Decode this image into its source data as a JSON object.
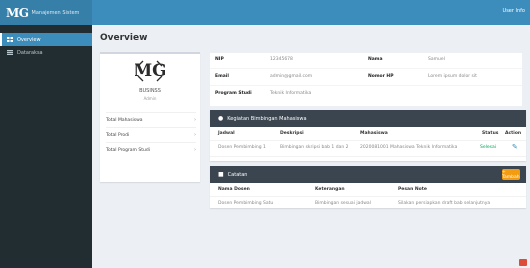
{
  "app": {
    "logo": "MG",
    "name": "Manajemen Sistem",
    "user": "User Info"
  },
  "sidebar": {
    "items": [
      {
        "label": "Overview",
        "icon": "dashboard-icon",
        "active": true
      },
      {
        "label": "Dataraksa",
        "icon": "database-icon",
        "active": false
      }
    ]
  },
  "page": {
    "title": "Overview"
  },
  "profile": {
    "name": "BUSINSS",
    "subtitle": "Admin",
    "links": [
      {
        "label": "Total Mahasiswa"
      },
      {
        "label": "Total Prodi"
      },
      {
        "label": "Total Program Studi"
      }
    ]
  },
  "info": {
    "rows": [
      {
        "l1": "NIP",
        "v1": "12345678",
        "l2": "Nama",
        "v2": "Samuel"
      },
      {
        "l1": "Email",
        "v1": "admin@gmail.com",
        "l2": "Nomor HP",
        "v2": "Lorem ipsum dolor sit"
      },
      {
        "l1": "Program Studi",
        "v1": "Teknik Informatika",
        "l2": "",
        "v2": ""
      }
    ]
  },
  "kegiatan": {
    "title": "Kegiatan Bimbingan Mahasiswa",
    "headers": [
      "Jadwal",
      "Deskripsi",
      "Mahasiswa",
      "Status",
      "Action"
    ],
    "rows": [
      {
        "jadwal": "Dosen Pembimbing 1",
        "deskripsi": "Bimbingan skripsi bab 1 dan 2",
        "mahasiswa": "2020081001 Mahasiswa Teknik Informatika",
        "status": "Selesai"
      }
    ]
  },
  "catatan": {
    "title": "Catatan",
    "add_label": "+ Tambah",
    "headers": [
      "Nama Dosen",
      "Keterangan",
      "Pesan Note"
    ],
    "rows": [
      {
        "nama": "Dosen Pembimbing Satu",
        "keterangan": "Bimbingan sesuai jadwal",
        "pesan": "Silakan persiapkan draft bab selanjutnya"
      }
    ]
  },
  "colors": {
    "primary": "#3c8dbc",
    "sidebar": "#222d32",
    "header_dark": "#3a4550",
    "warning": "#f39c12",
    "success": "#00a65a"
  }
}
